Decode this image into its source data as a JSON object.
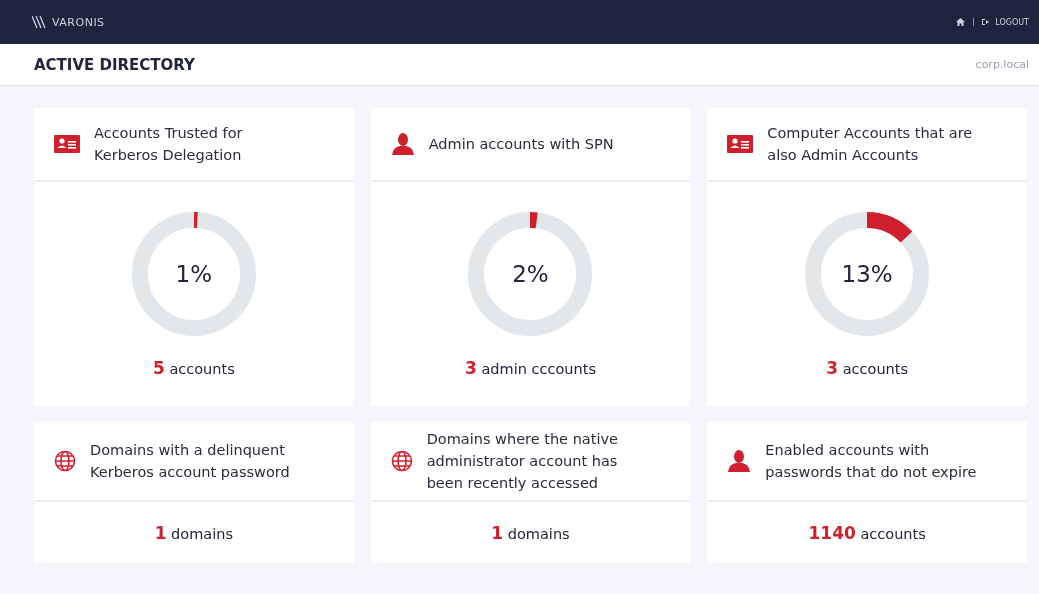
{
  "header": {
    "logo": "VARONIS",
    "logout": "LOGOUT"
  },
  "subheader": {
    "title": "ACTIVE DIRECTORY",
    "domain": "corp.local"
  },
  "cards": [
    {
      "kind": "donut",
      "title": "Accounts Trusted for Kerberos Delegation",
      "percent": "1%",
      "level": 0.01,
      "count": "5",
      "unit": "accounts"
    },
    {
      "kind": "donut",
      "title": "Admin accounts with SPN",
      "percent": "2%",
      "level": 0.02,
      "count": "3",
      "unit": "admin cccounts"
    },
    {
      "kind": "donut",
      "title": "Computer Accounts that are also Admin Accounts",
      "percent": "13%",
      "level": 0.13,
      "count": "3",
      "unit": "accounts"
    },
    {
      "kind": "count",
      "title": "Domains with a delinquent Kerberos account password",
      "count": "1",
      "unit": "domains"
    },
    {
      "kind": "count",
      "title": "Domains where the native administrator account has been recently accessed",
      "count": "1",
      "unit": "domains"
    },
    {
      "kind": "count",
      "title": "Enabled accounts with passwords that do not expire",
      "count": "1140",
      "unit": "accounts"
    }
  ]
}
